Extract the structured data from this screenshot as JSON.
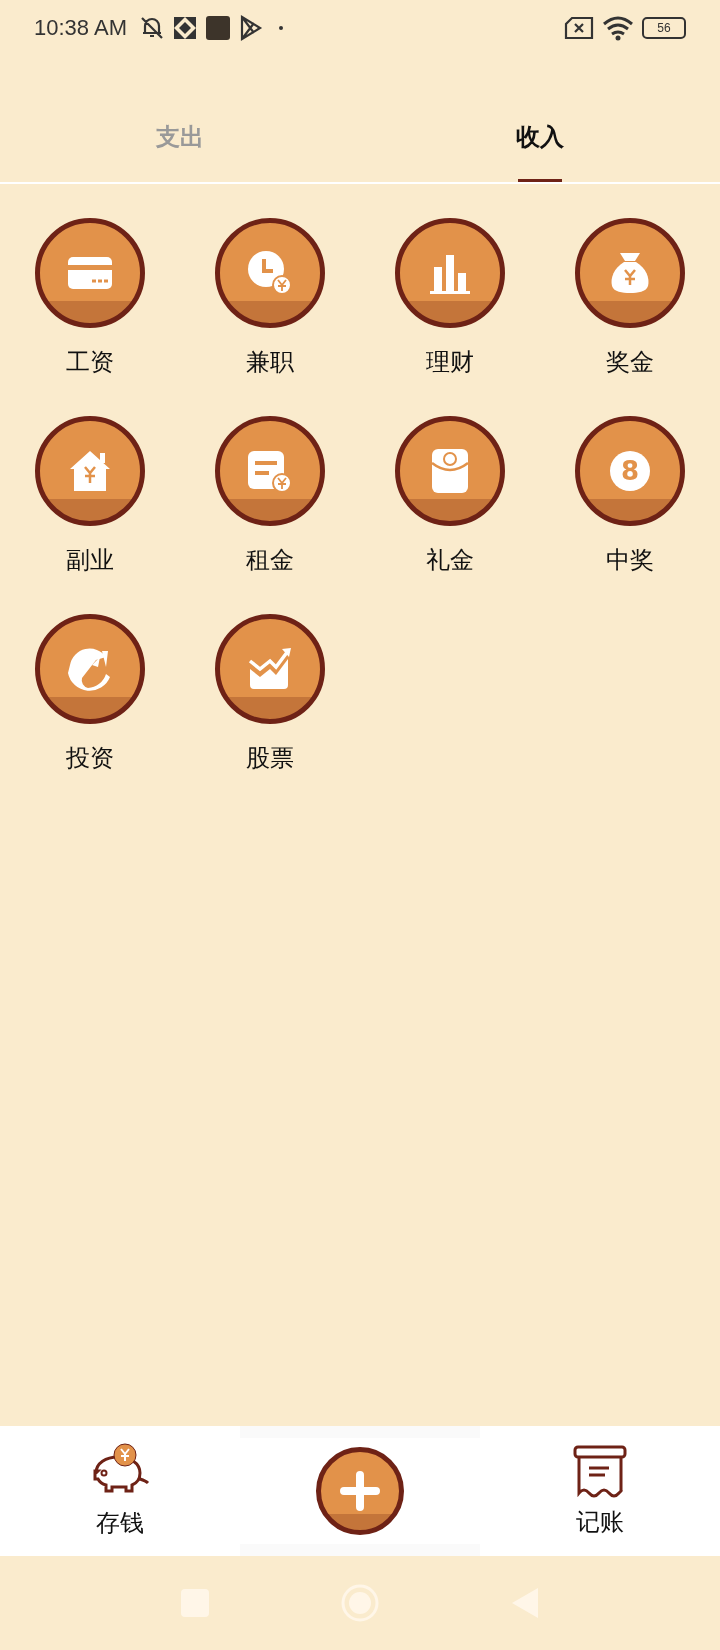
{
  "status_bar": {
    "time": "10:38 AM",
    "battery": "56"
  },
  "tabs": [
    {
      "label": "支出",
      "selected": false
    },
    {
      "label": "收入",
      "selected": true
    }
  ],
  "categories": [
    {
      "label": "工资",
      "kind": "card"
    },
    {
      "label": "兼职",
      "kind": "clock"
    },
    {
      "label": "理财",
      "kind": "bars"
    },
    {
      "label": "奖金",
      "kind": "bag"
    },
    {
      "label": "副业",
      "kind": "house"
    },
    {
      "label": "租金",
      "kind": "bill"
    },
    {
      "label": "礼金",
      "kind": "envelope"
    },
    {
      "label": "中奖",
      "kind": "ball",
      "icon_text": "8"
    },
    {
      "label": "投资",
      "kind": "swirl"
    },
    {
      "label": "股票",
      "kind": "stock"
    }
  ],
  "bottom_nav": [
    {
      "label": "存钱",
      "kind": "piggy"
    },
    {
      "kind": "add"
    },
    {
      "label": "记账",
      "kind": "ledger"
    }
  ]
}
